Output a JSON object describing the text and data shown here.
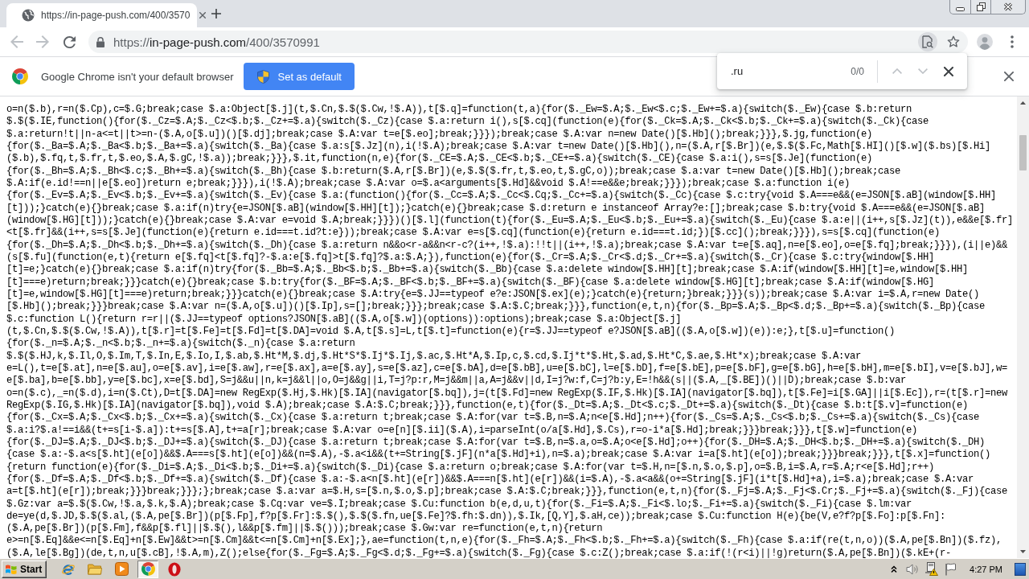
{
  "tabs": [
    {
      "title": "https://in-page-push.com/400/3570",
      "selected": true
    }
  ],
  "toolbar": {
    "back": {
      "disabled": true
    },
    "forward": {
      "disabled": true
    },
    "url": {
      "scheme": "https://",
      "host": "in-page-push.com",
      "path": "/400/3570991"
    },
    "find_button": {
      "pressed": true
    }
  },
  "infobar": {
    "message": "Google Chrome isn't your default browser",
    "button": "Set as default"
  },
  "find_bar": {
    "query": ".ru",
    "count": "0/0",
    "previous": {
      "disabled": true
    },
    "next": {
      "disabled": true
    }
  },
  "page_text": [
    "o=n($.b),r=n($.Cp),c=$.G;break;case $.a:Object[$.j](t,$.Cn,$.$($.Cw,!$.A)),t[$.q]=function(t,a){for($._Ew=$.A;$._Ew<$.c;$._Ew+=$.a){switch($._Ew){case $.b:return",
    "$.$($.IE,function(){for($._Cz=$.A;$._Cz<$.b;$._Cz+=$.a){switch($._Cz){case $.a:return i(),s[$.cq](function(e){for($._Ck=$.A;$._Ck<$.b;$._Ck+=$.a){switch($._Ck){case",
    "$.a:return!t||n-a<=t||t>=n-($.A,o[$.u])()[$.dj];break;case $.A:var t=e[$.eo];break;}}});break;case $.A:var n=new Date()[$.Hb]();break;}}},$.jg,function(e)",
    "{for($._Ba=$.A;$._Ba<$.b;$._Ba+=$.a){switch($._Ba){case $.a:s[$.Jz](n),i(!$.A);break;case $.A:var t=new Date()[$.Hb](),n=($.A,r[$.Br])(e,$.$($.Fc,Math[$.HI]()[$.w]($.bs)[$.Hi]",
    "($.b),$.fq,t,$.fr,t,$.eo,$.A,$.gC,!$.a));break;}}},$.it,function(n,e){for($._CE=$.A;$._CE<$.b;$._CE+=$.a){switch($._CE){case $.a:i(),s=s[$.Je](function(e)",
    "{for($._Bh=$.A;$._Bh<$.c;$._Bh+=$.a){switch($._Bh){case $.b:return($.A,r[$.Br])(e,$.$($.fr,t,$.eo,t,$.gC,o));break;case $.a:var t=new Date()[$.Hb]();break;case",
    "$.A:if(e.id!==n||e[$.eo])return e;break;}}}),i(!$.A);break;case $.A:var o=$.a<arguments[$.Hd]&&void $.A!==e&&e;break;}}});break;case $.a:function i(e)",
    "{for($._Ev=$.A;$._Ev<$.b;$._Ev+=$.a){switch($._Ev){case $.a:(function(){for($._Cc=$.A;$._Cc<$.Cq;$._Cc+=$.a){switch($._Cc){case $.c:try{void $.A===e&&(e=JSON[$.aB](window[$.HH]",
    "[t]));}catch(e){}break;case $.a:if(n)try{e=JSON[$.aB](window[$.HH][t]);}catch(e){}break;case $.d:return e instanceof Array?e:[];break;case $.b:try{void $.A===e&&(e=JSON[$.aB]",
    "(window[$.HG][t]));}catch(e){}break;case $.A:var e=void $.A;break;}}})()[$.l](function(t){for($._Eu=$.A;$._Eu<$.b;$._Eu+=$.a){switch($._Eu){case $.a:e||(i++,s[$.Jz](t)),e&&e[$.fr]",
    "<t[$.fr]&&(i++,s=s[$.Je](function(e){return e.id===t.id?t:e}));break;case $.A:var e=s[$.cq](function(e){return e.id===t.id;})[$.cc]();break;}}}),s=s[$.cq](function(e)",
    "{for($._Dh=$.A;$._Dh<$.b;$._Dh+=$.a){switch($._Dh){case $.a:return n&&o<r-a&&n<r-c?(i++,!$.a):!!t||(i++,!$.a);break;case $.A:var t=e[$.aq],n=e[$.eo],o=e[$.fq];break;}}}),(i||e)&&",
    "(s[$.fu](function(e,t){return e[$.fq]<t[$.fq]?-$.a:e[$.fq]>t[$.fq]?$.a:$.A;}),function(e){for($._Cr=$.A;$._Cr<$.d;$._Cr+=$.a){switch($._Cr){case $.c:try{window[$.HH]",
    "[t]=e;}catch(e){}break;case $.a:if(n)try{for($._Bb=$.A;$._Bb<$.b;$._Bb+=$.a){switch($._Bb){case $.a:delete window[$.HH][t];break;case $.A:if(window[$.HH][t]=e,window[$.HH]",
    "[t]===e)return;break;}}}catch(e){}break;case $.b:try{for($._BF=$.A;$._BF<$.b;$._BF+=$.a){switch($._BF){case $.a:delete window[$.HG][t];break;case $.A:if(window[$.HG]",
    "[t]=e,window[$.HG][t]===e)return;break;}}}catch(e){}break;case $.A:try{e=$.JJ==typeof e?e:JSON[$.ex](e);}catch(e){return;}break;}}}(s));break;case $.A:var i=$.A,r=new Date()",
    "[$.Hb]();break;}}}break;case $.A:var n=($.A,o[$.u])()[$.Ip],s=[];break;}}};break;case $.A:$.C;break;}}},function(e,t,n){for($._Bp=$.A;$._Bp<$.d;$._Bp+=$.a){switch($._Bp){case",
    "$.c:function L(){return r=r||($.JJ==typeof options?JSON[$.aB](($.A,o[$.w])(options)):options);break;case $.a:Object[$.j]",
    "(t,$.Cn,$.$($.Cw,!$.A)),t[$.r]=t[$.Fe]=t[$.Fd]=t[$.DA]=void $.A,t[$.s]=L,t[$.t]=function(e){r=$.JJ==typeof e?JSON[$.aB](($.A,o[$.w])(e)):e;},t[$.u]=function()",
    "{for($._n=$.A;$._n<$.b;$._n+=$.a){switch($._n){case $.a:return",
    "$.$($.HJ,k,$.Il,O,$.Im,T,$.In,E,$.Io,I,$.ab,$.Ht*M,$.dj,$.Ht*S*$.Ij*$.Ij,$.ac,$.Ht*A,$.Ip,c,$.cd,$.Ij*t*$.Ht,$.ad,$.Ht*C,$.ae,$.Ht*x);break;case $.A:var",
    "e=L(),t=e[$.at],n=e[$.au],o=e[$.av],i=e[$.aw],r=e[$.ax],a=e[$.ay],s=e[$.az],c=e[$.bA],d=e[$.bB],u=e[$.bC],l=e[$.bD],f=e[$.bE],p=e[$.bF],g=e[$.bG],h=e[$.bH],m=e[$.bI],v=e[$.bJ],w=",
    "e[$.ba],b=e[$.bb],y=e[$.bc],x=e[$.bd],S=j&&u||n,k=j&&l||o,O=j&&g||i,T=j?p:r,M=j&&m||a,A=j&&v||d,I=j?w:f,C=j?b:y,E=!h&&(s||($.A,_[$.BE])()||D);break;case $.b:var",
    "o=n($.c),_=n($.d),i=n($.Ct),D=t[$.DA]=new RegExp($.Hj,$.Hk)[$.IA](navigator[$.bq]),j=(t[$.Fd]=new RegExp($.IF,$.Hk)[$.IA](navigator[$.bq]),t[$.Fe]=i[$.GA]||i[$.Ec]),r=(t[$.r]=new",
    "RegExp($.IG,$.Hk)[$.IA](navigator[$.bq]),void $.A);break;case $.A:$.C;break;}}},function(e,t){for($._Dt=$.A;$._Dt<$.c;$._Dt+=$.a){switch($._Dt){case $.b:t[$.v]=function(e)",
    "{for($._Cx=$.A;$._Cx<$.b;$._Cx+=$.a){switch($._Cx){case $.a:return t;break;case $.A:for(var t=$.B,n=$.A;n<e[$.Hd];n++){for($._Cs=$.A;$._Cs<$.b;$._Cs+=$.a){switch($._Cs){case",
    "$.a:i?$.a!==i&&(t+=s[i-$.a]):t+=s[$.A],t+=a[r];break;case $.A:var o=e[n][$.ii]($.A),i=parseInt(o/a[$.Hd],$.Cs),r=o-i*a[$.Hd];break;}}}break;}}},t[$.w]=function(e)",
    "{for($._DJ=$.A;$._DJ<$.b;$._DJ+=$.a){switch($._DJ){case $.a:return t;break;case $.A:for(var t=$.B,n=$.a,o=$.A;o<e[$.Hd];o++){for($._DH=$.A;$._DH<$.b;$._DH+=$.a){switch($._DH)",
    "{case $.a:-$.a<s[$.ht](e[o])&&$.A===s[$.ht](e[o])&&(n=$.A),-$.a<i&&(t+=String[$.jF](n*a[$.Hd]+i),n=$.a);break;case $.A:var i=a[$.ht](e[o]);break;}}}break;}}},t[$.x]=function()",
    "{return function(e){for($._Di=$.A;$._Di<$.b;$._Di+=$.a){switch($._Di){case $.a:return o;break;case $.A:for(var t=$.H,n=[$.n,$.o,$.p],o=$.B,i=$.A,r=$.A;r<e[$.Hd];r++)",
    "{for($._Df=$.A;$._Df<$.b;$._Df+=$.a){switch($._Df){case $.a:-$.a<n[$.ht](e[r])&&$.A===n[$.ht](e[r])&&(i=$.A),-$.a<a&&(o+=String[$.jF](i*t[$.Hd]+a),i=$.a);break;case $.A:var",
    "a=t[$.ht](e[r]);break;}}}break;}}};};break;case $.a:var a=$.H,s=[$.n,$.o,$.p];break;case $.A:$.C;break;}}},function(e,t,n){for($._Fj=$.A;$._Fj<$.Cr;$._Fj+=$.a){switch($._Fj){case",
    "$.Gz:var a=$.$($.Cw,!$.a,$.k,$.A);break;case $.Cq:var ve=$.I;break;case $.Cu:function b(e,d,u,t){for($._Fi=$.A;$._Fi<$.lo;$._Fi+=$.a){switch($._Fi){case $.lm:var",
    "de=ye(d,$.JD,$.$($.al,($.A,pe[$.Br])(p[$.Fp],f?p[$.Fr]:$.$(),$.$($.fn,ue[$.Fe]?$.fh:$.dn)),$.Ik,[Q,Y],$.aH,ce));break;case $.Cu:function H(e){be(V,e?f?p[$.Fo]:p[$.Fn]:",
    "($.A,pe[$.Br])(p[$.Fm],f&&p[$.fl]||$.$(),l&&p[$.fm]||$.$()));break;case $.Gw:var re=function(e,t,n){return",
    "e>=n[$.Eq]&&e<=n[$.Eq]+n[$.Ew]&&t>=n[$.Cm]&&t<=n[$.Cm]+n[$.Ex];},ae=function(t,n,e){for($._Fh=$.A;$._Fh<$.b;$._Fh+=$.a){switch($._Fh){case $.a:if(re(t,n,o))($.A,pe[$.Bn])($.fz),",
    "($.A,le[$.Bg])(de,t,n,u[$.cB],!$.A,m),Z();else{for($._Fg=$.A;$._Fg<$.d;$._Fg+=$.a){switch($._Fg){case $.c:Z();break;case $.a:if(!(r<i)||!g)return($.A,pe[$.Bn])($.kE+(r-"
  ],
  "taskbar": {
    "start": "Start",
    "apps": [
      {
        "kind": "ie",
        "pressed": false
      },
      {
        "kind": "folder",
        "pressed": false
      },
      {
        "kind": "player",
        "pressed": false
      },
      {
        "kind": "chrome",
        "pressed": true
      },
      {
        "kind": "ring",
        "pressed": false
      }
    ],
    "clock": "4:27 PM"
  }
}
